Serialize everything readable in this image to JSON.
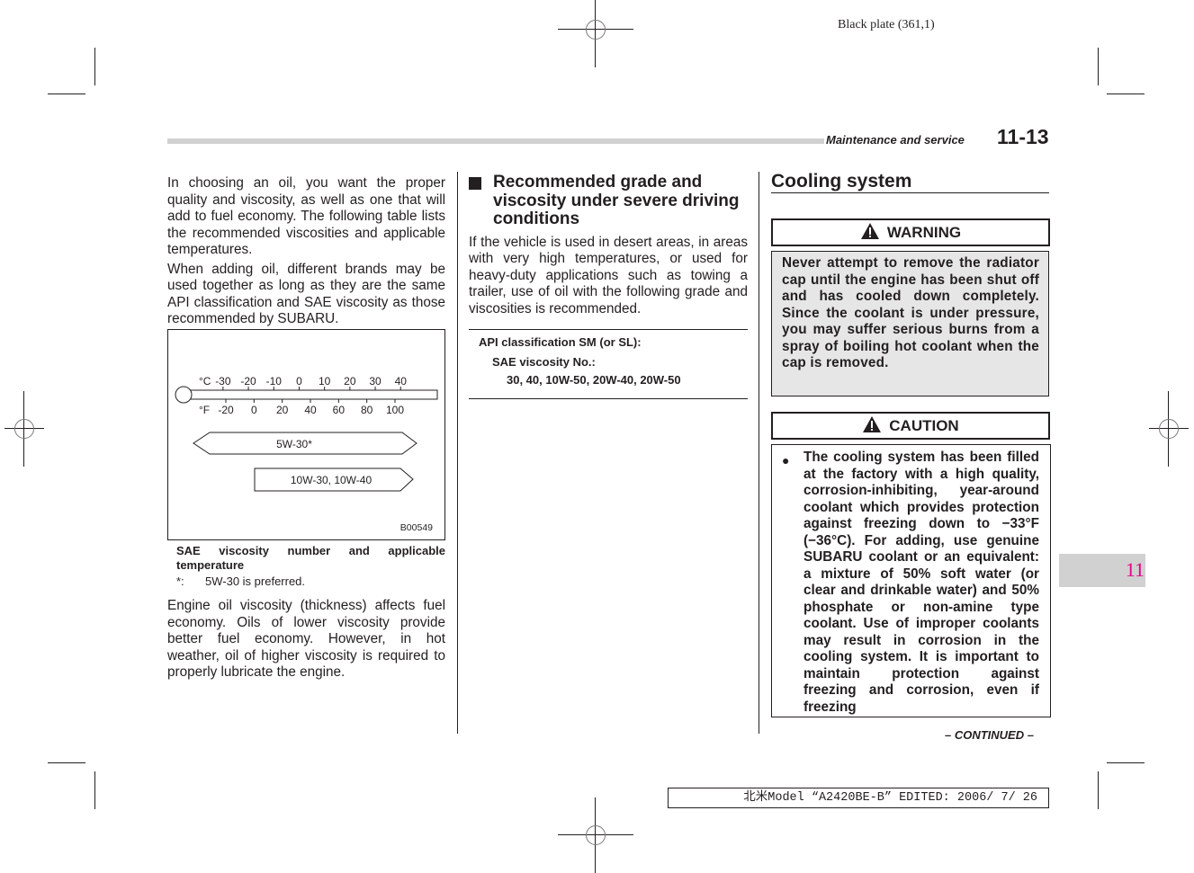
{
  "print_info": {
    "plate": "Black plate (361,1)",
    "footer": "北米Model “A2420BE-B” EDITED: 2006/ 7/ 26"
  },
  "header": {
    "section": "Maintenance and service",
    "page": "11-13"
  },
  "chapter_tab": "11",
  "column1": {
    "para1": "In choosing an oil, you want the proper quality and viscosity, as well as one that will add to fuel economy. The following table lists the recommended viscosities and applicable temperatures.",
    "para2": "When adding oil, different brands may be used together as long as they are the same API classification and SAE viscosity as those recommended by SUBARU.",
    "figure": {
      "celsius_unit": "°C",
      "fahrenheit_unit": "°F",
      "celsius_ticks": [
        "-30",
        "-20",
        "-10",
        "0",
        "10",
        "20",
        "30",
        "40"
      ],
      "fahrenheit_ticks": [
        "-20",
        "0",
        "20",
        "40",
        "60",
        "80",
        "100"
      ],
      "ranges": [
        {
          "label": "5W-30*",
          "from_f": "below -20",
          "to_f": "above 100"
        },
        {
          "label": "10W-30, 10W-40",
          "from_f": "0",
          "to_f": "above 100"
        }
      ],
      "figure_id": "B00549"
    },
    "caption": "SAE viscosity number and applicable temperature",
    "note_key": "*:",
    "note_text": "5W-30 is preferred.",
    "para3": "Engine oil viscosity (thickness) affects fuel economy. Oils of lower viscosity provide better fuel economy. However, in hot weather, oil of higher viscosity is required to properly lubricate the engine."
  },
  "column2": {
    "heading": "Recommended grade and viscosity under severe driving conditions",
    "body": "If the vehicle is used in desert areas, in areas with very high temperatures, or used for heavy-duty applications such as towing a trailer, use of oil with the following grade and viscosities is recommended.",
    "spec": {
      "api": "API classification SM (or SL):",
      "sae_label": "SAE viscosity No.:",
      "sae_values": "30, 40, 10W-50, 20W-40, 20W-50"
    }
  },
  "column3": {
    "heading": "Cooling system",
    "warning": {
      "label": "WARNING",
      "icon": "warning-triangle-icon",
      "text": "Never attempt to remove the radiator cap until the engine has been shut off and has cooled down completely. Since the coolant is under pressure, you may suffer serious burns from a spray of boiling hot coolant when the cap is removed."
    },
    "caution": {
      "label": "CAUTION",
      "icon": "warning-triangle-icon",
      "bullet": "●",
      "text": "The cooling system has been filled at the factory with a high quality, corrosion-inhibiting, year-around coolant which provides protection against freezing down to −33°F (−36°C). For adding, use genuine SUBARU coolant or an equivalent: a mixture of 50% soft water (or clear and drinkable water) and 50% phosphate or non-amine type coolant. Use of improper coolants may result in corrosion in the cooling system. It is important to maintain protection against freezing and corrosion, even if freezing"
    },
    "continued": "– CONTINUED –"
  }
}
